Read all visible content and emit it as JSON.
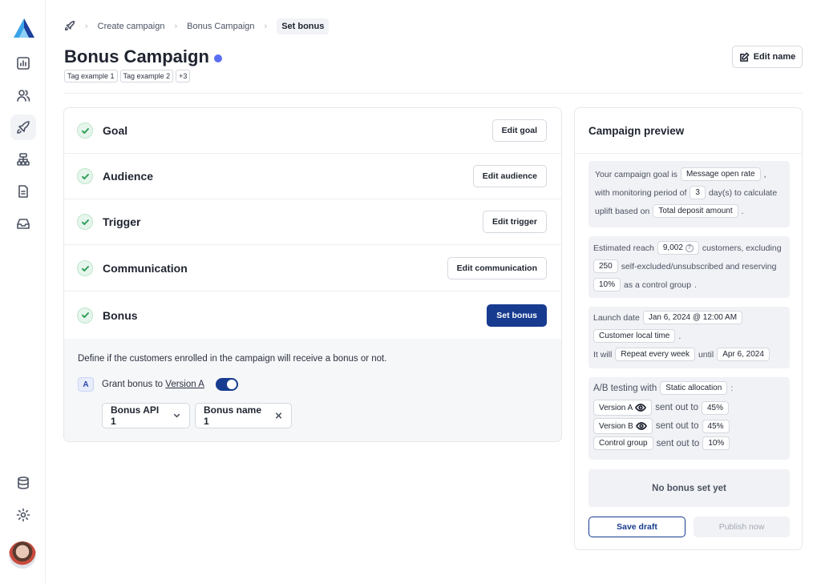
{
  "breadcrumb": {
    "items": [
      "Create campaign",
      "Bonus Campaign"
    ],
    "current": "Set bonus"
  },
  "header": {
    "title": "Bonus Campaign",
    "tags": [
      "Tag example 1",
      "Tag example 2",
      "+3"
    ],
    "edit_name_label": "Edit name"
  },
  "steps": [
    {
      "label": "Goal",
      "button": "Edit goal"
    },
    {
      "label": "Audience",
      "button": "Edit audience"
    },
    {
      "label": "Trigger",
      "button": "Edit trigger"
    },
    {
      "label": "Communication",
      "button": "Edit communication"
    },
    {
      "label": "Bonus",
      "button": "Set bonus"
    }
  ],
  "bonus": {
    "description": "Define if the customers enrolled in the campaign will receive a bonus or not.",
    "version_badge": "A",
    "grant_prefix": "Grant bonus to",
    "grant_link": "Version A",
    "toggle_on": true,
    "api_select": "Bonus API 1",
    "name_select": "Bonus name 1"
  },
  "preview": {
    "title": "Campaign preview",
    "goal": {
      "t1": "Your campaign goal is",
      "goal_value": "Message open rate",
      "t2": ",",
      "t3": "with monitoring period of",
      "period": "3",
      "t4": "day(s) to calculate",
      "t5": "uplift based on",
      "metric": "Total deposit amount",
      "t6": "."
    },
    "reach": {
      "t1": "Estimated reach",
      "reach": "9,002",
      "t2": "customers, excluding",
      "excluded": "250",
      "t3": "self-excluded/unsubscribed and reserving",
      "control": "10%",
      "t4": "as a control group",
      "t5": "."
    },
    "launch": {
      "t1": "Launch date",
      "date": "Jan 6, 2024 @ 12:00 AM",
      "tz": "Customer local time",
      "t2": ".",
      "t3": "It will",
      "repeat": "Repeat every week",
      "t4": "until",
      "until": "Apr 6, 2024"
    },
    "ab": {
      "t1": "A/B testing with",
      "allocation": "Static allocation",
      "t2": ":",
      "sent_out_to": "sent out to",
      "rows": [
        {
          "name": "Version A",
          "eye": true,
          "pct": "45%"
        },
        {
          "name": "Version B",
          "eye": true,
          "pct": "45%"
        },
        {
          "name": "Control group",
          "eye": false,
          "pct": "10%"
        }
      ]
    },
    "no_bonus": "No bonus set yet",
    "save_label": "Save draft",
    "publish_label": "Publish now"
  }
}
